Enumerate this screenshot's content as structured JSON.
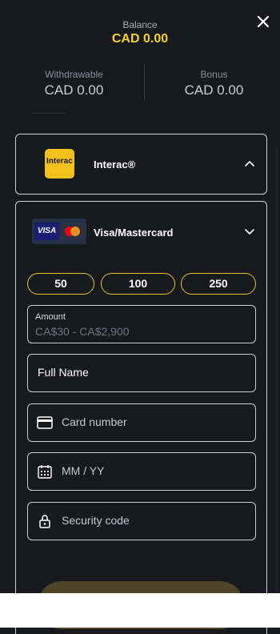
{
  "balance": {
    "label": "Balance",
    "value": "CAD 0.00",
    "accent": "#f7d21c"
  },
  "withdrawable": {
    "label": "Withdrawable",
    "value": "CAD 0.00"
  },
  "bonus": {
    "label": "Bonus",
    "value": "CAD 0.00"
  },
  "methods": {
    "interac": {
      "name": "Interac®",
      "logo_text": "Interac",
      "expanded": false
    },
    "visa": {
      "name": "Visa/Mastercard",
      "logo_text": "VISA",
      "expanded": true
    }
  },
  "quick_amounts": [
    "50",
    "100",
    "250"
  ],
  "form": {
    "amount": {
      "label": "Amount",
      "placeholder": "CA$30 - CA$2,900"
    },
    "full_name": {
      "placeholder": "Full Name"
    },
    "card_number": {
      "placeholder": "Card number",
      "icon": "card-icon"
    },
    "expiry": {
      "placeholder": "MM / YY",
      "icon": "calendar-icon"
    },
    "security_code": {
      "placeholder": "Security code",
      "icon": "lock-icon"
    }
  },
  "colors": {
    "background": "#17191d",
    "border": "#cfd2d8",
    "accent": "#e6c21c"
  }
}
